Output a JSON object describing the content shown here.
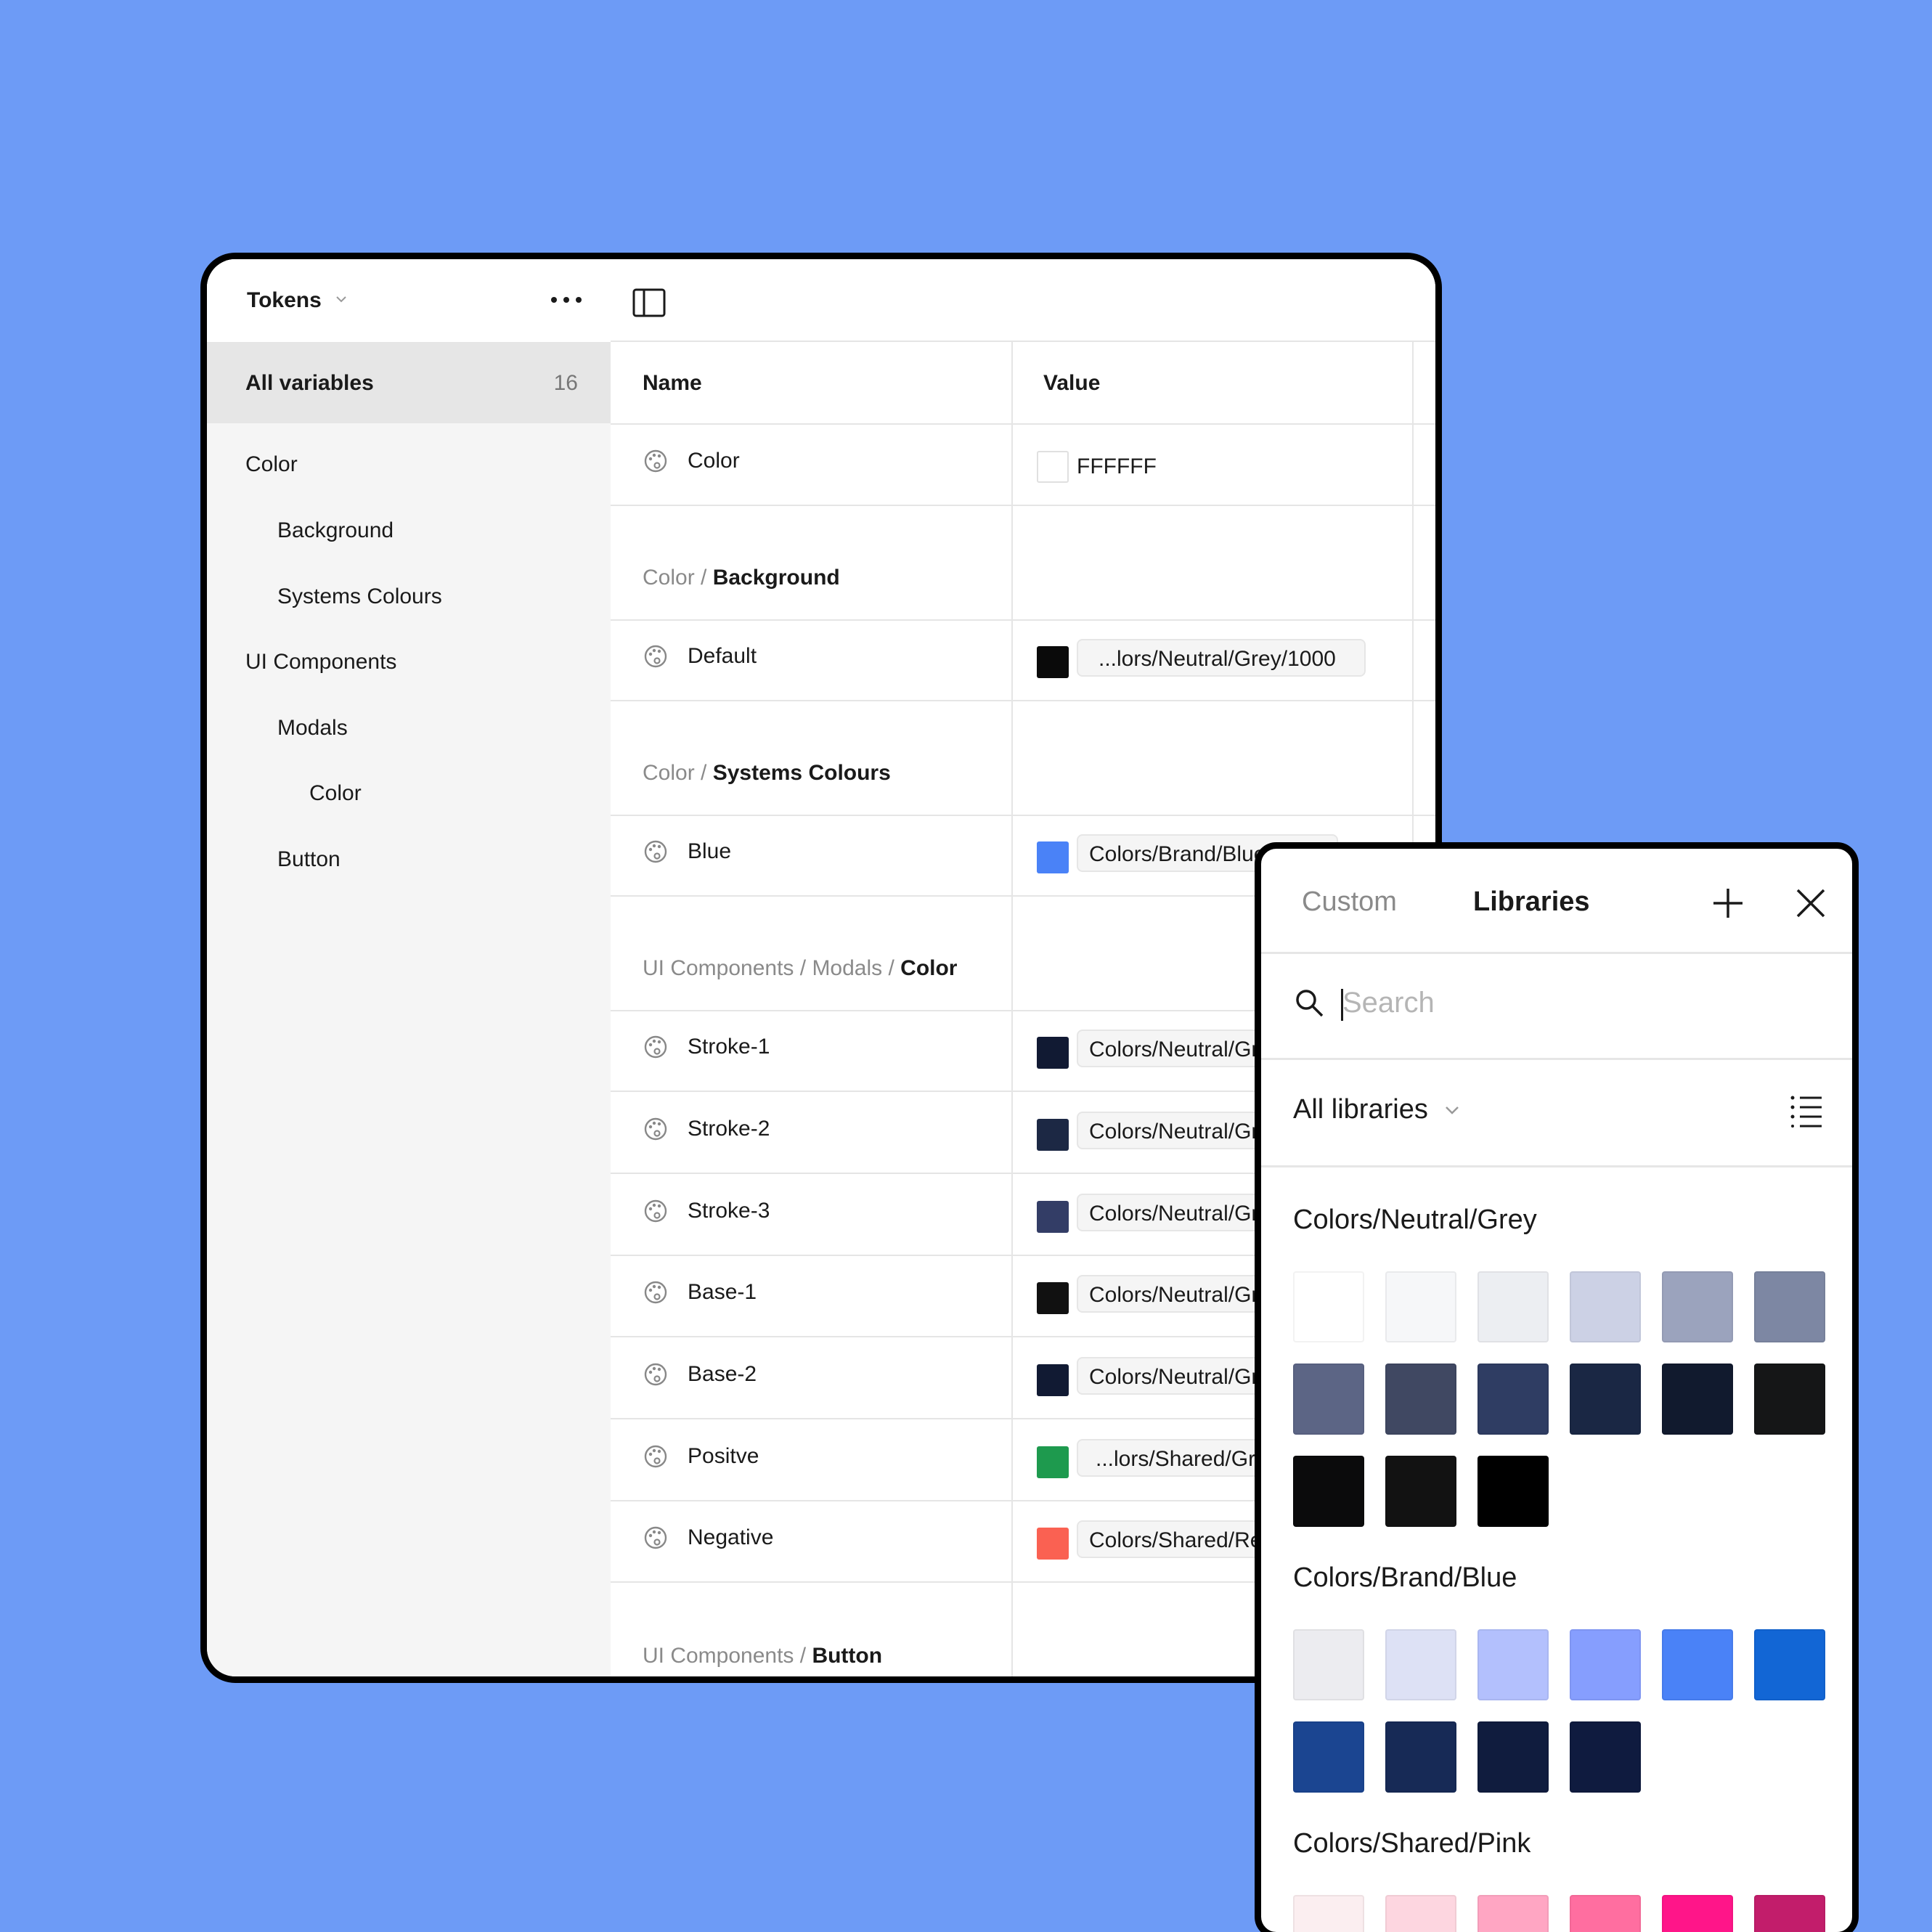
{
  "sidebar": {
    "title": "Tokens",
    "all_label": "All variables",
    "all_count": "16",
    "items": [
      {
        "label": "Color"
      },
      {
        "label": "Background"
      },
      {
        "label": "Systems Colours"
      },
      {
        "label": "UI Components"
      },
      {
        "label": "Modals"
      },
      {
        "label": "Color"
      },
      {
        "label": "Button"
      }
    ]
  },
  "table": {
    "col_name": "Name",
    "col_value": "Value",
    "rows": [
      {
        "name": "Color",
        "value": "FFFFFF",
        "color": "#ffffff"
      },
      {
        "name": "Default",
        "value": "...lors/Neutral/Grey/1000",
        "color": "#0a0a0a"
      },
      {
        "name": "Blue",
        "value": "Colors/Brand/Blue/400",
        "color": "#4a82f7"
      },
      {
        "name": "Stroke-1",
        "value": "Colors/Neutral/Grey/900",
        "color": "#111a33"
      },
      {
        "name": "Stroke-2",
        "value": "Colors/Neutral/Grey/800",
        "color": "#1c2844"
      },
      {
        "name": "Stroke-3",
        "value": "Colors/Neutral/Grey/700",
        "color": "#333d66"
      },
      {
        "name": "Base-1",
        "value": "Colors/Neutral/Grey/1000",
        "color": "#111111"
      },
      {
        "name": "Base-2",
        "value": "Colors/Neutral/Grey/900",
        "color": "#111a33"
      },
      {
        "name": "Positve",
        "value": "...lors/Shared/Green",
        "color": "#1e9a4e"
      },
      {
        "name": "Negative",
        "value": "Colors/Shared/Red",
        "color": "#fa6152"
      }
    ],
    "groups": {
      "g1_prefix": "Color / ",
      "g1_bold": "Background",
      "g2_prefix": "Color / ",
      "g2_bold": "Systems Colours",
      "g3_prefix": "UI Components / Modals / ",
      "g3_bold": "Color",
      "g4_prefix": "UI Components / ",
      "g4_bold": "Button"
    }
  },
  "popup": {
    "tab_custom": "Custom",
    "tab_libraries": "Libraries",
    "search_placeholder": "Search",
    "library_filter": "All libraries",
    "sections": [
      {
        "title": "Colors/Neutral/Grey",
        "colors": [
          "#ffffff",
          "#f6f7f9",
          "#eceef2",
          "#ccd1e5",
          "#9ba3bd",
          "#7d87a3",
          "#5c6585",
          "#404862",
          "#2f3d63",
          "#1a2744",
          "#111a2e",
          "#151617",
          "#0b0b0c",
          "#121212",
          "#000000"
        ]
      },
      {
        "title": "Colors/Brand/Blue",
        "colors": [
          "#ececf0",
          "#dde1f5",
          "#b3c0fd",
          "#869efe",
          "#4a82f7",
          "#1266d5",
          "#1b4591",
          "#172a56",
          "#101c3e",
          "#0f1b3f"
        ]
      },
      {
        "title": "Colors/Shared/Pink",
        "colors": [
          "#fbeef0",
          "#fdd6e0",
          "#ffa6c3",
          "#ff6ea0",
          "#ff1589",
          "#c21d6b"
        ]
      }
    ]
  }
}
